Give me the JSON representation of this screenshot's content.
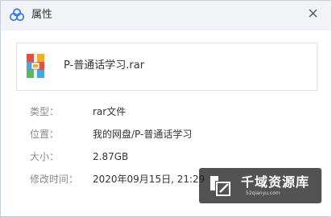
{
  "window": {
    "title": "属性",
    "app_icon": "cloud-icon",
    "close_icon": "close-icon"
  },
  "file": {
    "icon": "rar-archive-icon",
    "name": "P-普通话学习.rar"
  },
  "properties": [
    {
      "label": "类型：",
      "value": "rar文件"
    },
    {
      "label": "位置：",
      "value": "我的网盘/P-普通话学习"
    },
    {
      "label": "大小：",
      "value": "2.87GB"
    },
    {
      "label": "修改时间：",
      "value": "2020年09月15日, 21:29"
    }
  ],
  "watermark": {
    "text": "千域资源库",
    "subtext": "52qianyu.com"
  },
  "colors": {
    "titlebar": "#f1f3f6",
    "label": "#8a8a8a",
    "value": "#333333",
    "cloud_blue": "#3b7de8"
  }
}
